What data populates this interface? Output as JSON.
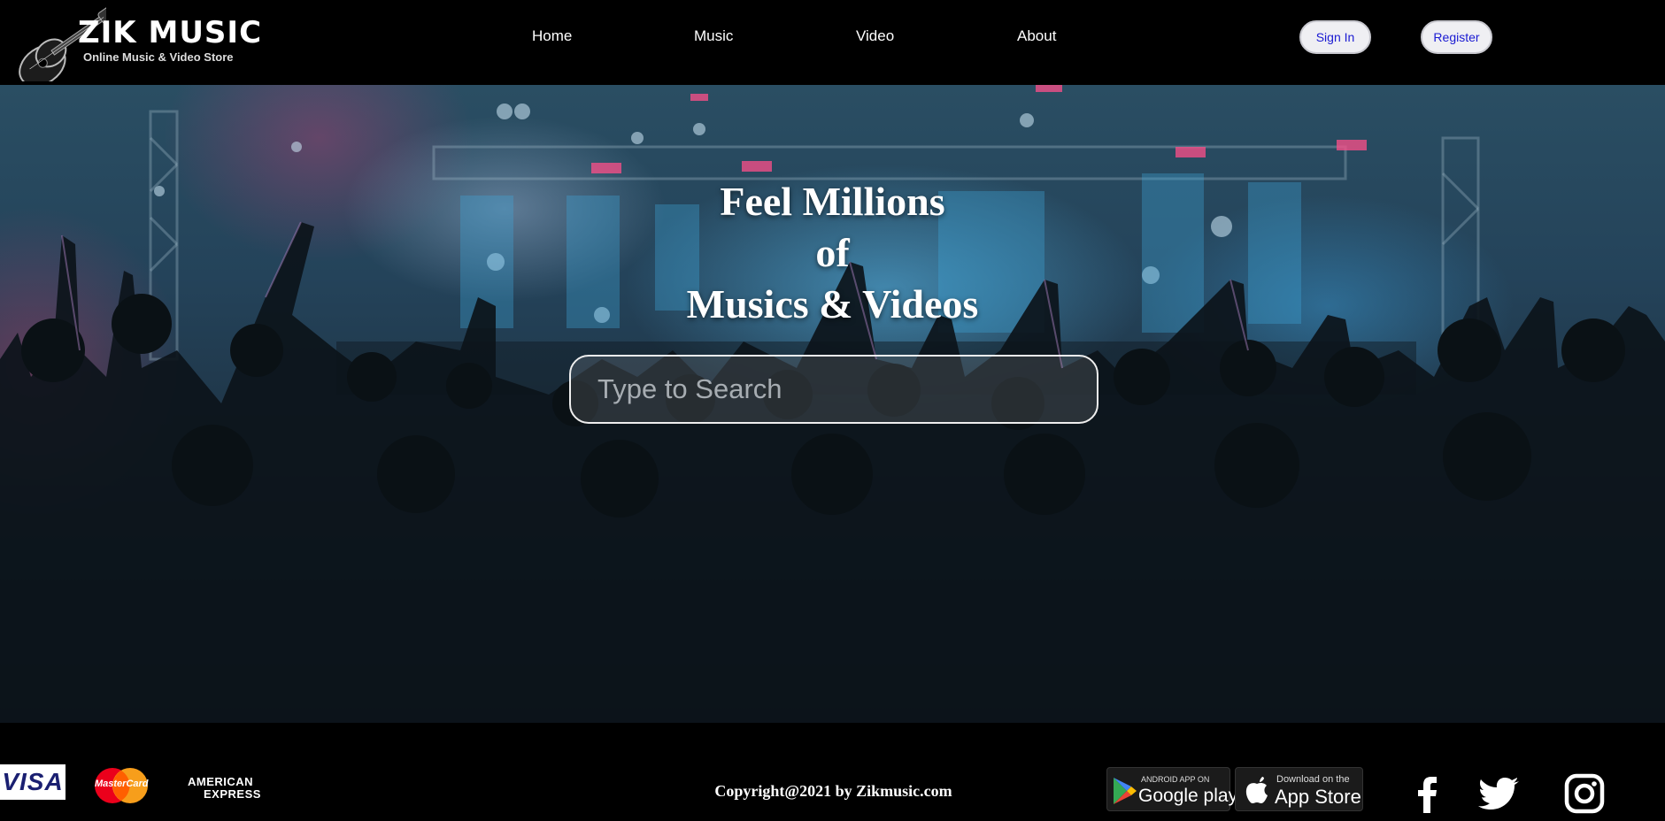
{
  "header": {
    "logo": {
      "title": "ZIK MUSIC",
      "subtitle": "Online Music & Video Store",
      "icon": "guitar-icon"
    },
    "nav": [
      {
        "label": "Home"
      },
      {
        "label": "Music"
      },
      {
        "label": "Video"
      },
      {
        "label": "About"
      }
    ],
    "sign_in_label": "Sign In",
    "register_label": "Register"
  },
  "hero": {
    "title_lines": [
      "Feel Millions",
      "of",
      "Musics & Videos"
    ],
    "search_placeholder": "Type to Search"
  },
  "footer": {
    "payment": {
      "visa": "VISA",
      "mastercard": "MasterCard",
      "amex_line1": "AMERICAN",
      "amex_line2": "EXPRESS"
    },
    "copyright": "Copyright@2021 by Zikmusic.com",
    "google_play": {
      "small": "ANDROID APP ON",
      "big": "Google play"
    },
    "app_store": {
      "small": "Download on the",
      "big": "App Store"
    },
    "social_icons": [
      "facebook-icon",
      "twitter-icon",
      "instagram-icon"
    ]
  },
  "colors": {
    "header_bg": "#000000",
    "button_text": "#1a1ad2",
    "button_bg": "#efeff3",
    "hero_tint": "#24435a",
    "mastercard_red": "#eb001b",
    "mastercard_orange": "#f79e1b",
    "visa_blue": "#1a1f71"
  }
}
